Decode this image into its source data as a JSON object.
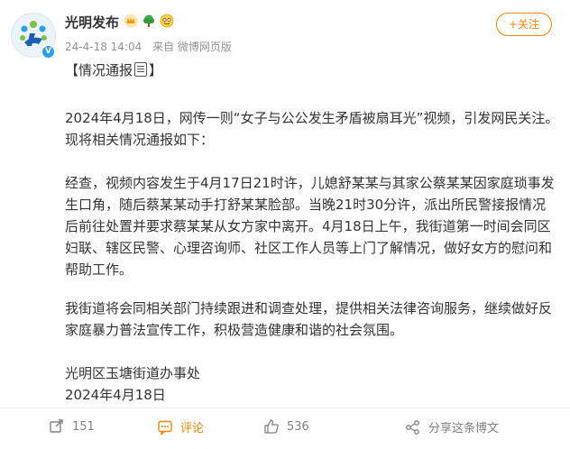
{
  "post": {
    "author": "光明发布",
    "time": "24-4-18 14:04",
    "source": "来自 微博网页版",
    "follow_label": "+关注"
  },
  "content": {
    "title_open": "【情况通报",
    "title_close": "】",
    "paragraph1": "2024年4月18日，网传一则“女子与公公发生矛盾被扇耳光”视频，引发网民关注。现将相关情况通报如下：",
    "paragraph2": "经查，视频内容发生于4月17日21时许，儿媳舒某某与其家公蔡某某因家庭琐事发生口角，随后蔡某某动手打舒某某脸部。当晚21时30分许，派出所民警接报情况后前往处置并要求蔡某某从女方家中离开。4月18日上午，我街道第一时间会同区妇联、辖区民警、心理咨询师、社区工作人员等上门了解情况，做好女方的慰问和帮助工作。",
    "paragraph3": "我街道将会同相关部门持续跟进和调查处理，提供相关法律咨询服务，继续做好反家庭暴力普法宣传工作，积极营造健康和谐的社会氛围。",
    "signature": "光明区玉塘街道办事处",
    "date": "2024年4月18日"
  },
  "actions": {
    "repost_count": "151",
    "comment_label": "评论",
    "like_count": "536",
    "share_label": "分享这条博文"
  },
  "colors": {
    "accent": "#ff8200",
    "text": "#333333",
    "muted": "#939393",
    "footer_text": "#808080",
    "verify": "#2aa1f0"
  },
  "icons": [
    "avatar-logo",
    "verified-badge-icon",
    "crown-badge-icon",
    "tree-badge-icon",
    "emoji-badge-icon",
    "document-icon",
    "repost-icon",
    "comment-icon",
    "like-icon",
    "share-icon"
  ]
}
